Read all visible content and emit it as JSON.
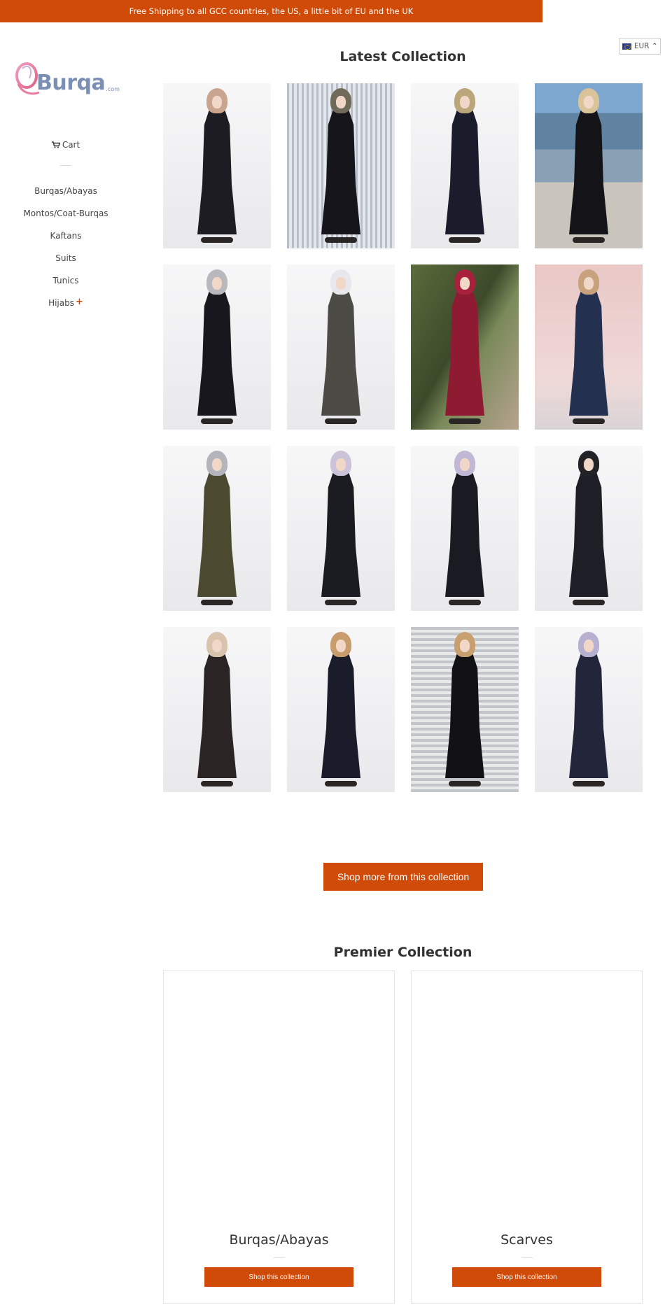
{
  "promo": {
    "text": "Free Shipping to all GCC countries, the US, a little bit of EU and the UK"
  },
  "currency": {
    "selected": "EUR",
    "icon": "eu-flag-icon"
  },
  "logo": {
    "name": "Burqa",
    "suffix": ".com"
  },
  "sidebar": {
    "cart_label": "Cart",
    "items": [
      {
        "label": "Burqas/Abayas"
      },
      {
        "label": "Montos/Coat-Burqas"
      },
      {
        "label": "Kaftans"
      },
      {
        "label": "Suits"
      },
      {
        "label": "Tunics"
      },
      {
        "label": "Hijabs",
        "expandable": true
      }
    ]
  },
  "latest": {
    "title": "Latest Collection",
    "products": [
      {
        "bg": "plain",
        "hijab": "#c9a48e",
        "dress": "#1c1c22"
      },
      {
        "bg": "stripes",
        "hijab": "#6f6a5a",
        "dress": "#15151b"
      },
      {
        "bg": "plain",
        "hijab": "#b9a67a",
        "dress": "#1a1c2c"
      },
      {
        "bg": "sea",
        "hijab": "#d8c39a",
        "dress": "#141418"
      },
      {
        "bg": "plain",
        "hijab": "#b9b9bd",
        "dress": "#17171d"
      },
      {
        "bg": "plain",
        "hijab": "#e8e8ec",
        "dress": "#4d4b45"
      },
      {
        "bg": "garden",
        "hijab": "#a8213c",
        "dress": "#8e1b32"
      },
      {
        "bg": "pink",
        "hijab": "#c7a27c",
        "dress": "#23304f"
      },
      {
        "bg": "plain",
        "hijab": "#b4b4bc",
        "dress": "#4b4a30"
      },
      {
        "bg": "plain",
        "hijab": "#cbc3d8",
        "dress": "#1b1b22"
      },
      {
        "bg": "plain",
        "hijab": "#c0b8d4",
        "dress": "#1a1a22"
      },
      {
        "bg": "plain",
        "hijab": "#232327",
        "dress": "#1e1e26"
      },
      {
        "bg": "plain",
        "hijab": "#d8c3ad",
        "dress": "#2a2524"
      },
      {
        "bg": "plain",
        "hijab": "#c89c6c",
        "dress": "#1b1c2a"
      },
      {
        "bg": "stripes2",
        "hijab": "#c8a070",
        "dress": "#121214"
      },
      {
        "bg": "plain",
        "hijab": "#b8b0d0",
        "dress": "#23253a"
      }
    ],
    "shop_more_label": "Shop more from this collection"
  },
  "premier": {
    "title": "Premier Collection",
    "cards": [
      {
        "title": "Burqas/Abayas",
        "button": "Shop this collection"
      },
      {
        "title": "Scarves",
        "button": "Shop this collection"
      }
    ]
  },
  "colors": {
    "accent": "#d04a08"
  }
}
